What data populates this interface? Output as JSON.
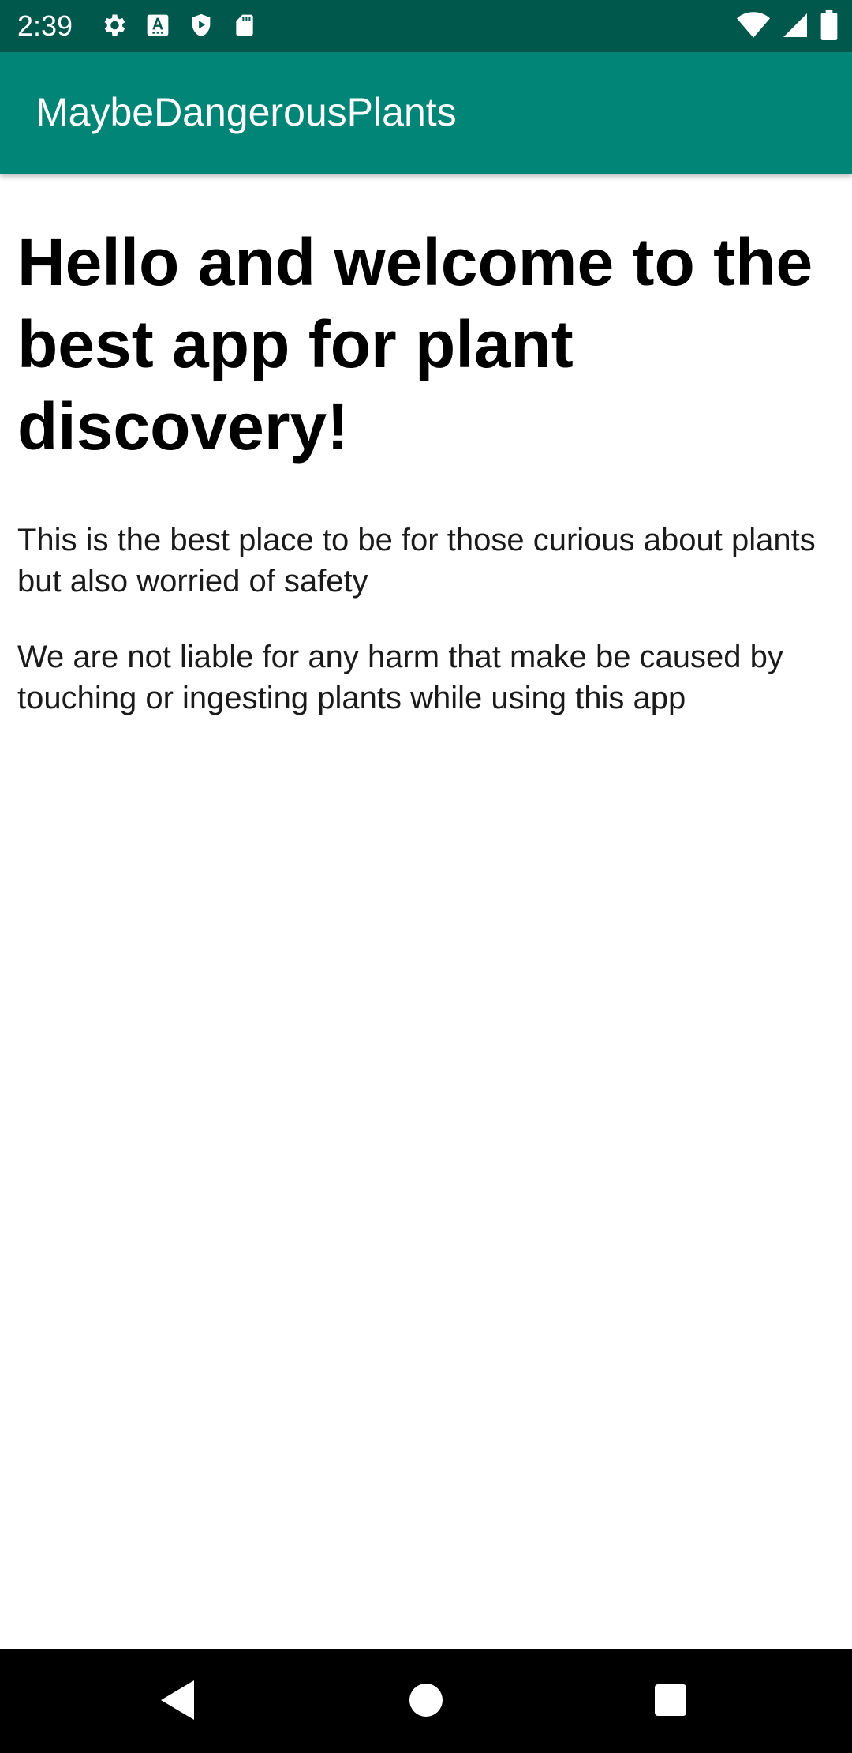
{
  "status_bar": {
    "time": "2:39",
    "background": "#00574B",
    "left_icons": [
      "settings-gear-icon",
      "font-a-icon",
      "shield-play-icon",
      "sd-card-icon"
    ],
    "right_icons": [
      "wifi-icon",
      "cellular-signal-icon",
      "battery-icon"
    ]
  },
  "app_bar": {
    "title": "MaybeDangerousPlants",
    "background": "#008577"
  },
  "main": {
    "headline": "Hello and welcome to the best app for plant discovery!",
    "paragraph_1": "This is the best place to be for those curious about plants but also worried of safety",
    "paragraph_2": "We are not liable for any harm that make be caused by touching or ingesting plants while using this app"
  },
  "nav_bar": {
    "background": "#000000",
    "buttons": [
      "back-icon",
      "home-icon",
      "recents-icon"
    ]
  }
}
